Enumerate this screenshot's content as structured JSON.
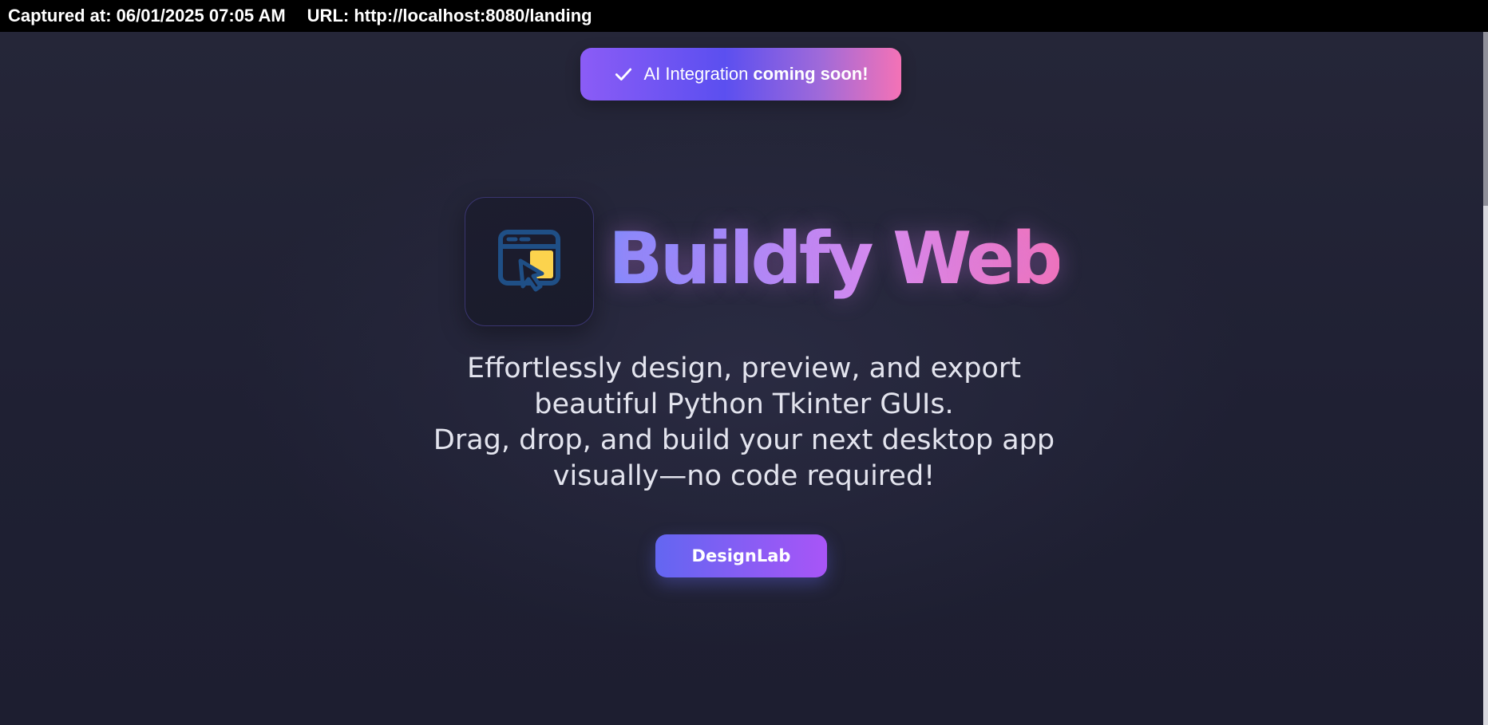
{
  "capture": {
    "captured_at": "Captured at: 06/01/2025 07:05 AM",
    "url": "URL: http://localhost:8080/landing"
  },
  "banner": {
    "icon": "check-icon",
    "text": "AI Integration",
    "emphasis": "coming soon!"
  },
  "hero": {
    "logo_icon": "window-cursor-icon",
    "title": "Buildfy Web",
    "tagline_lines": [
      "Effortlessly design, preview, and export",
      "beautiful Python Tkinter GUIs.",
      "Drag, drop, and build your next desktop app",
      "visually—no code required!"
    ]
  },
  "cta": {
    "label": "DesignLab"
  },
  "colors": {
    "background": "#1f2033",
    "accent_start": "#6366f1",
    "accent_end": "#a855f7",
    "pink": "#f472b6",
    "logo_stroke": "#1f4f86",
    "logo_fill": "#fcd34d"
  }
}
